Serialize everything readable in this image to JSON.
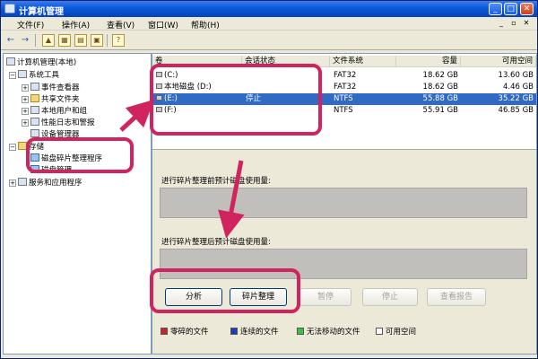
{
  "window": {
    "title": "计算机管理"
  },
  "menu": [
    "文件(F)",
    "操作(A)",
    "查看(V)",
    "窗口(W)",
    "帮助(H)"
  ],
  "tree": {
    "root": "计算机管理(本地)",
    "system_tools": "系统工具",
    "event_viewer": "事件查看器",
    "shared_folders": "共享文件夹",
    "local_users": "本地用户和组",
    "perf_logs": "性能日志和警报",
    "device_manager": "设备管理器",
    "storage": "存储",
    "defrag": "磁盘碎片整理程序",
    "disk_mgmt": "磁盘管理",
    "services": "服务和应用程序"
  },
  "volumes": {
    "headers": {
      "volume": "卷",
      "status": "会话状态",
      "fs": "文件系统",
      "capacity": "容量",
      "free": "可用空间"
    },
    "rows": [
      {
        "volume": "(C:)",
        "status": "",
        "fs": "FAT32",
        "capacity": "18.62 GB",
        "free": "13.60 GB"
      },
      {
        "volume": "本地磁盘 (D:)",
        "status": "",
        "fs": "FAT32",
        "capacity": "18.62 GB",
        "free": "4.46 GB"
      },
      {
        "volume": "(E:)",
        "status": "停止",
        "fs": "NTFS",
        "capacity": "55.88 GB",
        "free": "35.22 GB"
      },
      {
        "volume": "(F:)",
        "status": "",
        "fs": "NTFS",
        "capacity": "55.91 GB",
        "free": "46.85 GB"
      }
    ]
  },
  "defrag": {
    "before_label": "进行碎片整理前预计磁盘使用量:",
    "after_label": "进行碎片整理后预计磁盘使用量:",
    "buttons": {
      "analyze": "分析",
      "defragment": "碎片整理",
      "pause": "暂停",
      "stop": "停止",
      "report": "查看报告"
    }
  },
  "legend": [
    {
      "label": "零碎的文件",
      "color": "#c0262d"
    },
    {
      "label": "连续的文件",
      "color": "#1c3fb4"
    },
    {
      "label": "无法移动的文件",
      "color": "#3fbf3f"
    },
    {
      "label": "可用空间",
      "color": "#ffffff"
    }
  ],
  "annotation_color": "#d0245f"
}
